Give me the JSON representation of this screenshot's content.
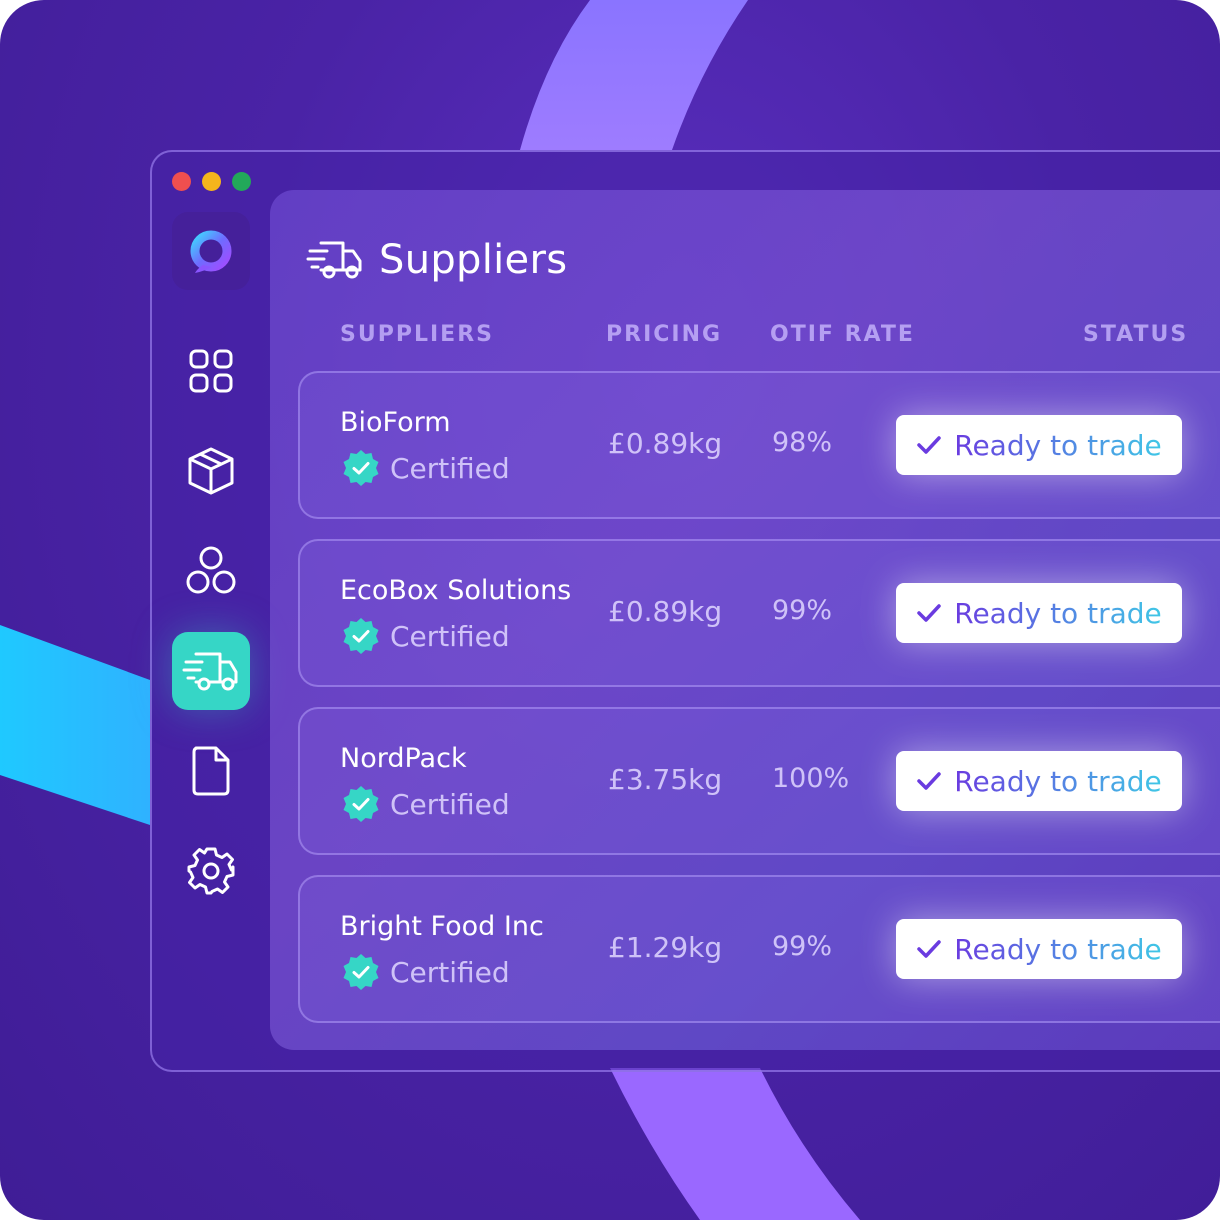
{
  "window": {
    "traffic_lights": [
      "red",
      "yellow",
      "green"
    ]
  },
  "sidebar": {
    "logo_icon": "app-logo-icon",
    "items": [
      {
        "id": "dashboard",
        "icon": "grid-icon",
        "active": false
      },
      {
        "id": "products",
        "icon": "box-icon",
        "active": false
      },
      {
        "id": "groups",
        "icon": "circles-icon",
        "active": false
      },
      {
        "id": "suppliers",
        "icon": "truck-icon",
        "active": true
      },
      {
        "id": "documents",
        "icon": "document-icon",
        "active": false
      },
      {
        "id": "settings",
        "icon": "gear-icon",
        "active": false
      }
    ]
  },
  "main": {
    "title": "Suppliers",
    "title_icon": "truck-icon",
    "columns": [
      "SUPPLIERS",
      "PRICING",
      "OTIF RATE",
      "STATUS"
    ],
    "rows": [
      {
        "name": "BioForm",
        "certification": "Certified",
        "price": "£0.89kg",
        "otif": "98%",
        "status": "Ready to trade"
      },
      {
        "name": "EcoBox Solutions",
        "certification": "Certified",
        "price": "£0.89kg",
        "otif": "99%",
        "status": "Ready to trade"
      },
      {
        "name": "NordPack",
        "certification": "Certified",
        "price": "£3.75kg",
        "otif": "100%",
        "status": "Ready to trade"
      },
      {
        "name": "Bright Food Inc",
        "certification": "Certified",
        "price": "£1.29kg",
        "otif": "99%",
        "status": "Ready to trade"
      }
    ]
  },
  "colors": {
    "background": "#4a23a6",
    "active_nav": "#36d6c6",
    "badge": "#36d6c6",
    "status_text_start": "#6a3be0",
    "status_text_end": "#3fc7e6"
  }
}
